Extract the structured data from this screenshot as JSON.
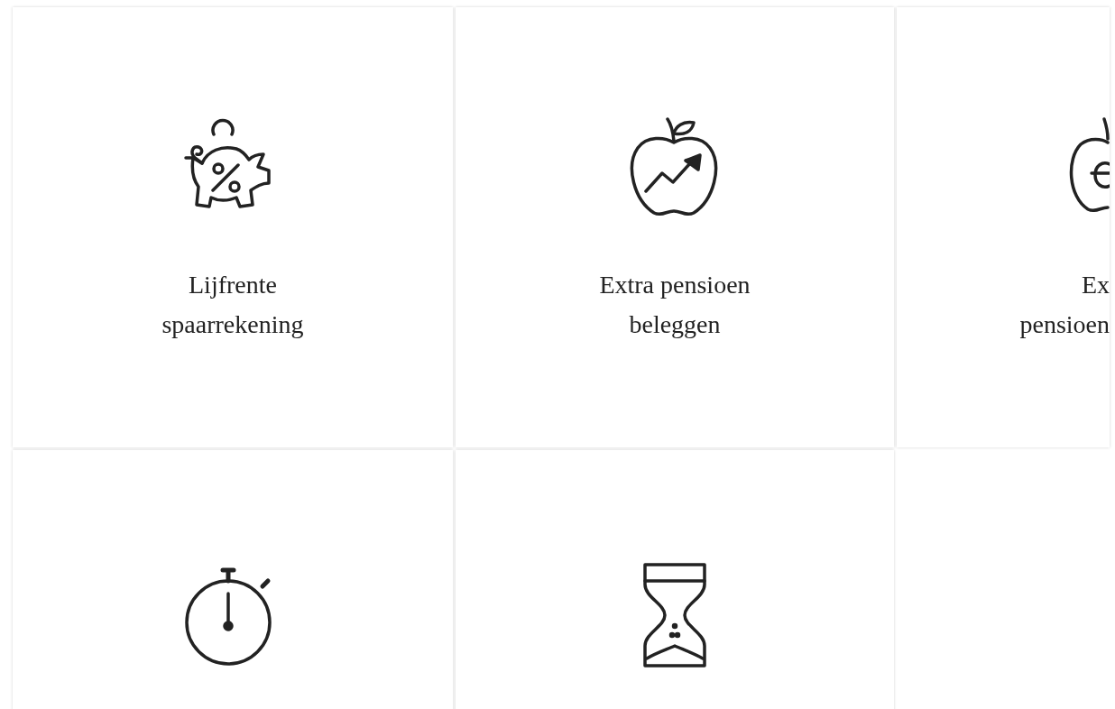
{
  "cards": [
    {
      "kind": "piggy",
      "cut": false,
      "lines": [
        "Lijfrente",
        "spaarrekening"
      ]
    },
    {
      "kind": "apple",
      "cut": false,
      "lines": [
        "Extra pensioen",
        "beleggen"
      ]
    },
    {
      "kind": "euro",
      "cut": true,
      "lines": [
        "Ex",
        "pensioen"
      ]
    },
    {
      "kind": "stopwatch",
      "cut": false
    },
    {
      "kind": "hourglass",
      "cut": false
    }
  ]
}
